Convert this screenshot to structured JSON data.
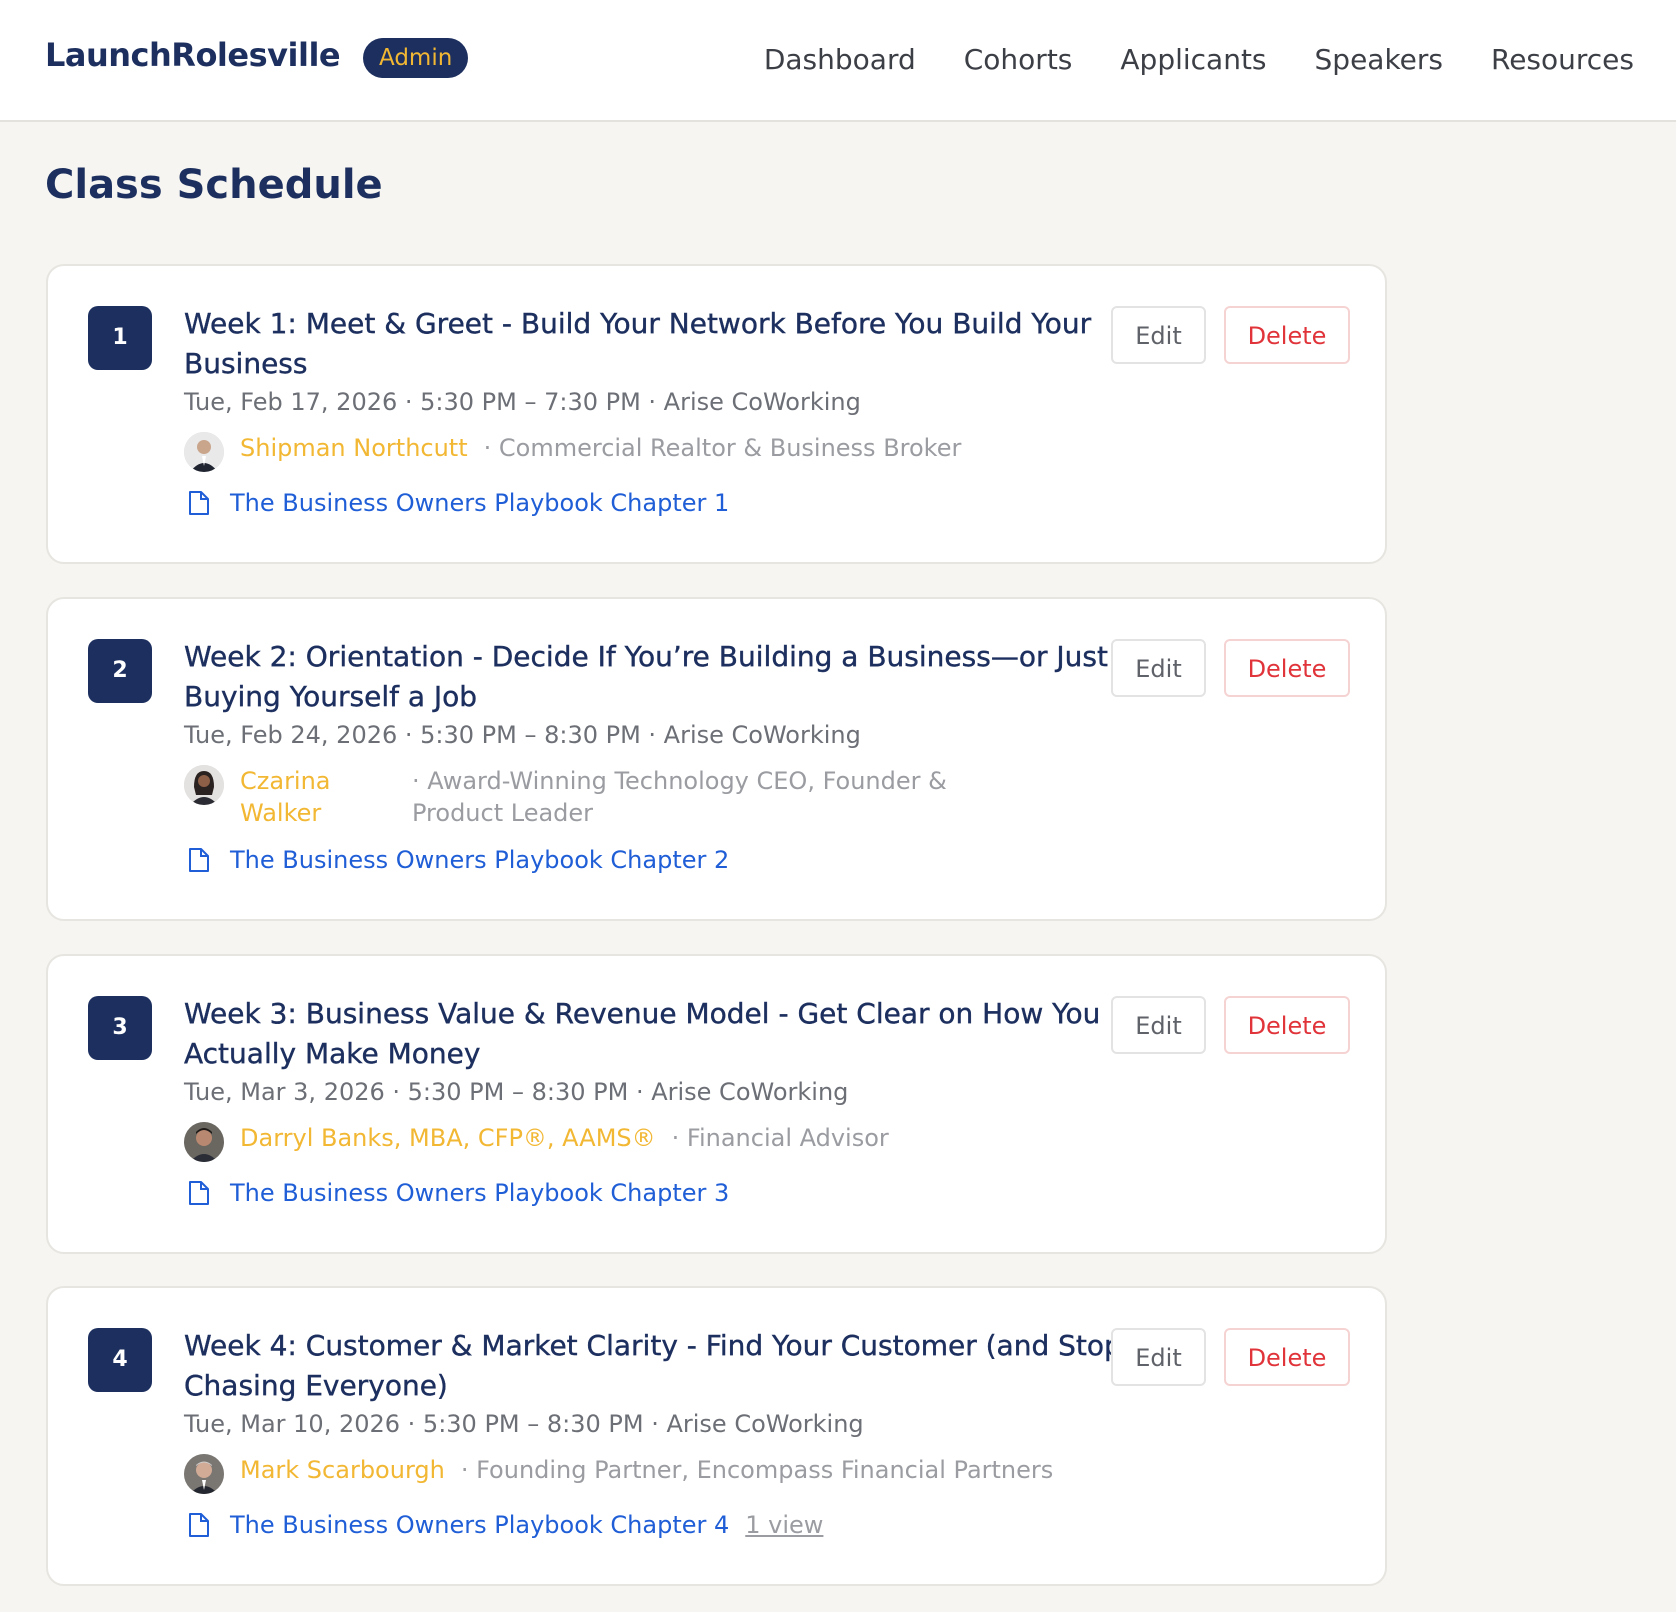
{
  "header": {
    "brand": "LaunchRolesville",
    "badge": "Admin",
    "nav": [
      "Dashboard",
      "Cohorts",
      "Applicants",
      "Speakers",
      "Resources"
    ]
  },
  "page": {
    "title": "Class Schedule"
  },
  "actions": {
    "edit_label": "Edit",
    "delete_label": "Delete"
  },
  "classes": [
    {
      "number": "1",
      "title": "Week 1: Meet & Greet - Build Your Network Before You Build Your Business",
      "meta": "Tue, Feb 17, 2026 · 5:30 PM – 7:30 PM · Arise CoWorking",
      "speaker_name": "Shipman Northcutt",
      "speaker_role": "· Commercial Realtor & Business Broker",
      "resource": "The Business Owners Playbook Chapter 1"
    },
    {
      "number": "2",
      "title": "Week 2: Orientation - Decide If You’re Building a Business—or Just Buying Yourself a Job",
      "meta": "Tue, Feb 24, 2026 · 5:30 PM – 8:30 PM · Arise CoWorking",
      "speaker_name": "Czarina Walker",
      "speaker_role": "· Award-Winning Technology CEO, Founder & Product Leader",
      "resource": "The Business Owners Playbook Chapter 2"
    },
    {
      "number": "3",
      "title": "Week 3: Business Value & Revenue Model - Get Clear on How You Actually Make Money",
      "meta": "Tue, Mar 3, 2026 · 5:30 PM – 8:30 PM · Arise CoWorking",
      "speaker_name": "Darryl Banks, MBA, CFP®, AAMS®",
      "speaker_role": "· Financial Advisor",
      "resource": "The Business Owners Playbook Chapter 3"
    },
    {
      "number": "4",
      "title": "Week 4: Customer & Market Clarity - Find Your Customer (and Stop Chasing Everyone)",
      "meta": "Tue, Mar 10, 2026 · 5:30 PM – 8:30 PM · Arise CoWorking",
      "speaker_name": "Mark Scarbourgh",
      "speaker_role": "· Founding Partner, Encompass Financial Partners",
      "resource": "The Business Owners Playbook Chapter 4",
      "views": "1 view"
    }
  ]
}
